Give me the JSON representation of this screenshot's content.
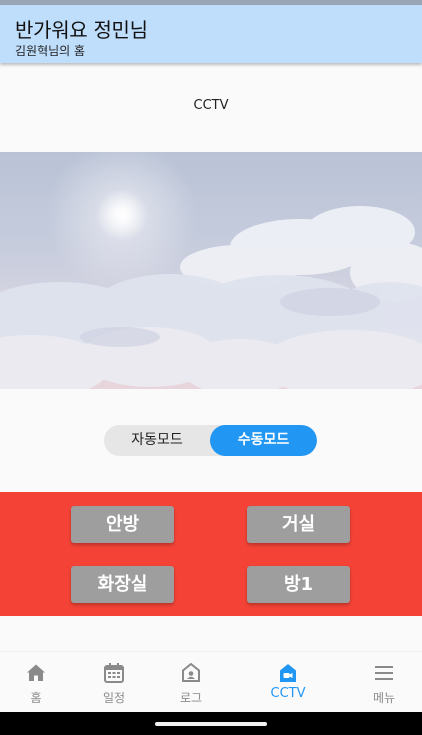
{
  "header": {
    "greeting": "반가워요 정민님",
    "home_name": "김원혁님의 홈"
  },
  "page": {
    "title": "CCTV"
  },
  "mode_toggle": {
    "auto_label": "자동모드",
    "manual_label": "수동모드",
    "selected": "수동모드"
  },
  "rooms": [
    {
      "label": "안방"
    },
    {
      "label": "거실"
    },
    {
      "label": "화장실"
    },
    {
      "label": "방1"
    }
  ],
  "bottom_nav": {
    "active": "CCTV",
    "items": [
      {
        "label": "홈",
        "icon": "home-icon"
      },
      {
        "label": "일정",
        "icon": "calendar-icon"
      },
      {
        "label": "로그",
        "icon": "log-icon"
      },
      {
        "label": "CCTV",
        "icon": "camera-icon"
      },
      {
        "label": "메뉴",
        "icon": "menu-icon"
      }
    ]
  },
  "colors": {
    "header_bg": "#bfdefb",
    "accent": "#2196f3",
    "room_panel": "#f44336",
    "room_button": "#9e9e9e"
  }
}
